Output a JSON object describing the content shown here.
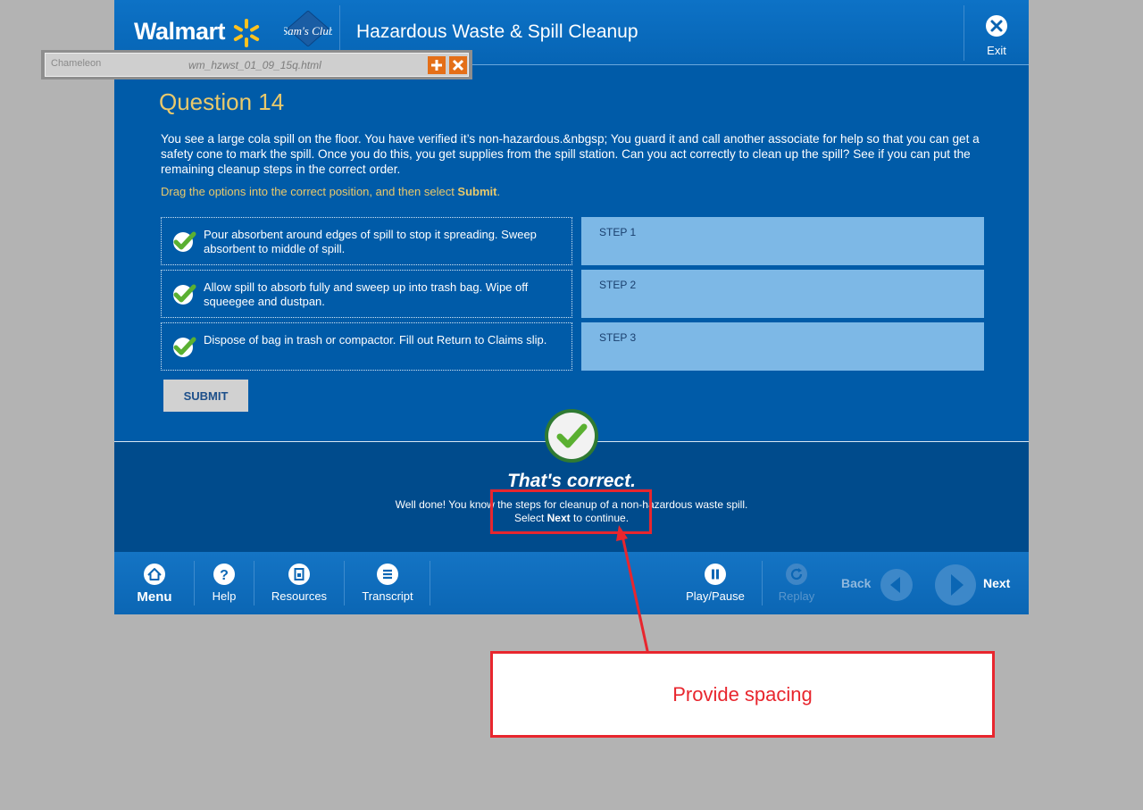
{
  "header": {
    "brand": "Walmart",
    "sams_logo": "Sam's Club",
    "course_title": "Hazardous Waste & Spill Cleanup",
    "exit_label": "Exit"
  },
  "chameleon": {
    "logo": "Chameleon",
    "file": "wm_hzwst_01_09_15q.html"
  },
  "question": {
    "title": "Question 14",
    "text": "You see a large cola spill on the floor.  You have verified it’s non-hazardous.&nbgsp; You guard it and call another associate for help so that you can get a safety cone to mark the spill.  Once you do this, you get supplies from the spill station.  Can you act correctly to clean up the spill?  See if you can put the remaining cleanup steps in the correct order.",
    "instruction_prefix": "Drag the options into the correct position, and then select ",
    "instruction_bold": "Submit",
    "instruction_suffix": ".",
    "options": [
      "Pour absorbent around edges of spill to stop it spreading.  Sweep absorbent to middle of spill.",
      "Allow spill to absorb fully and sweep up into trash bag.  Wipe off squeegee and dustpan.",
      "Dispose of bag in trash or compactor.  Fill out Return to Claims slip."
    ],
    "steps": [
      "STEP 1",
      "STEP 2",
      "STEP 3"
    ],
    "submit_label": "SUBMIT"
  },
  "feedback": {
    "title": "That's correct.",
    "line1": "Well done!  You know the steps for cleanup of a non-hazardous waste spill.",
    "line2_prefix": "Select ",
    "line2_bold": "Next",
    "line2_suffix": " to continue."
  },
  "footer": {
    "menu": "Menu",
    "help": "Help",
    "resources": "Resources",
    "transcript": "Transcript",
    "play_pause": "Play/Pause",
    "replay": "Replay",
    "back": "Back",
    "next": "Next"
  },
  "annotation": {
    "note": "Provide spacing"
  },
  "colors": {
    "primary_blue": "#005ba8",
    "gold": "#e9c96b",
    "annotation_red": "#e8262e",
    "check_green": "#5ab031"
  }
}
